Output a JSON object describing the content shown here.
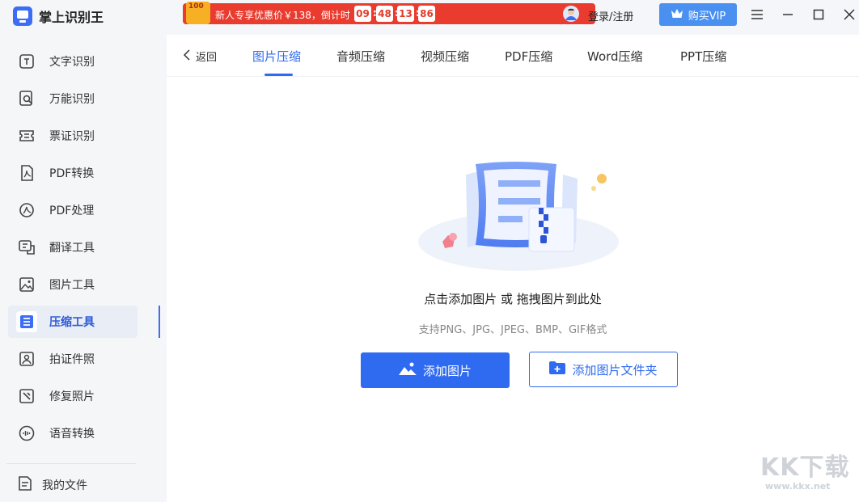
{
  "app": {
    "title": "掌上识别王"
  },
  "sidebar": {
    "items": [
      {
        "label": "文字识别",
        "icon": "text-recognition-icon"
      },
      {
        "label": "万能识别",
        "icon": "universal-recognition-icon"
      },
      {
        "label": "票证识别",
        "icon": "ticket-recognition-icon"
      },
      {
        "label": "PDF转换",
        "icon": "pdf-convert-icon"
      },
      {
        "label": "PDF处理",
        "icon": "pdf-process-icon"
      },
      {
        "label": "翻译工具",
        "icon": "translate-icon"
      },
      {
        "label": "图片工具",
        "icon": "image-tools-icon"
      },
      {
        "label": "压缩工具",
        "icon": "compress-icon",
        "active": true
      },
      {
        "label": "拍证件照",
        "icon": "id-photo-icon"
      },
      {
        "label": "修复照片",
        "icon": "photo-repair-icon"
      },
      {
        "label": "语音转换",
        "icon": "voice-convert-icon"
      }
    ],
    "my_files": "我的文件"
  },
  "topbar": {
    "promo": {
      "badge": "100",
      "text": "新人专享优惠价￥138，倒计时",
      "countdown": [
        "09",
        "48",
        "13",
        "86"
      ]
    },
    "login": "登录/注册",
    "vip": "购买VIP"
  },
  "tabs": {
    "back": "返回",
    "items": [
      "图片压缩",
      "音频压缩",
      "视频压缩",
      "PDF压缩",
      "Word压缩",
      "PPT压缩"
    ],
    "active_index": 0
  },
  "dropzone": {
    "title": "点击添加图片 或 拖拽图片到此处",
    "subtitle": "支持PNG、JPG、JPEG、BMP、GIF格式",
    "add_image": "添加图片",
    "add_folder": "添加图片文件夹"
  },
  "watermark": {
    "main": "KK下载",
    "sub": "www.kkx.net"
  },
  "colors": {
    "accent": "#2f6bf0",
    "promo": "#ea3b2f",
    "vip": "#4a90f1"
  }
}
